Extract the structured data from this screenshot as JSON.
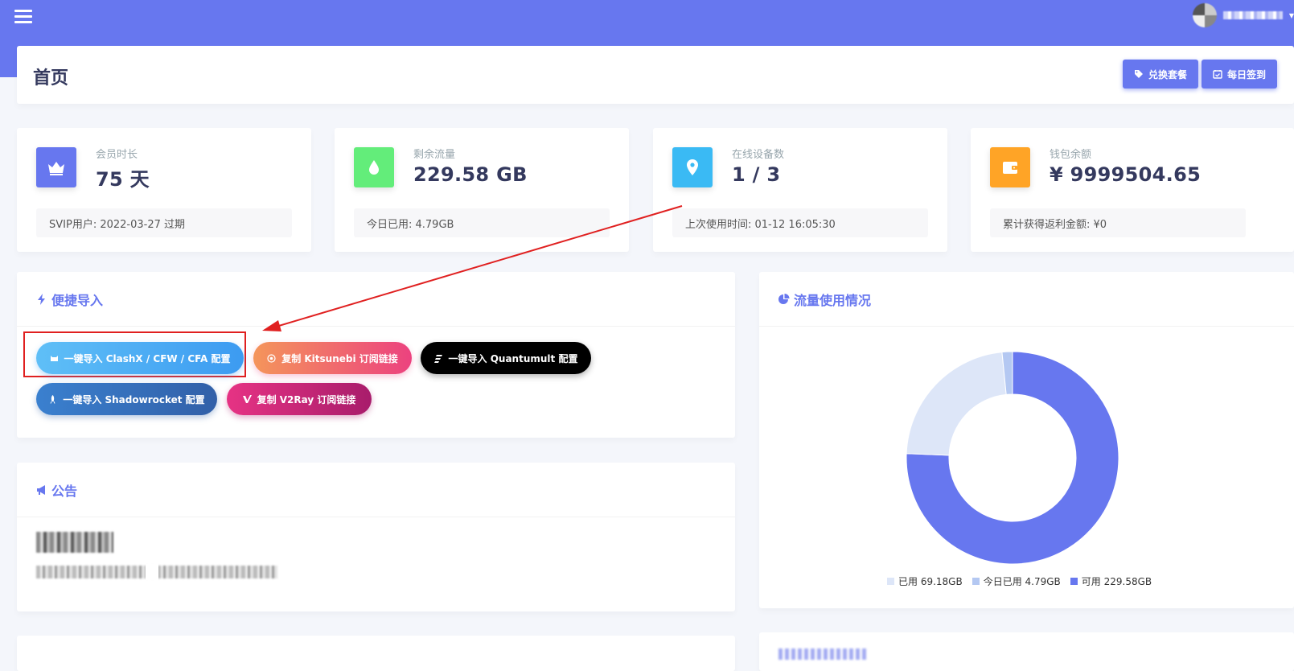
{
  "header": {
    "title": "首页",
    "buttons": [
      {
        "label": "兑换套餐",
        "icon": "tag-icon"
      },
      {
        "label": "每日签到",
        "icon": "calendar-check-icon"
      }
    ]
  },
  "stats": [
    {
      "label": "会员时长",
      "value": "75 天",
      "footer": "SVIP用户: 2022-03-27 过期",
      "icon": "crown-icon",
      "color": "#6777ef"
    },
    {
      "label": "剩余流量",
      "value": "229.58 GB",
      "footer": "今日已用: 4.79GB",
      "icon": "droplet-icon",
      "color": "#63ed7a"
    },
    {
      "label": "在线设备数",
      "value": "1 / 3",
      "footer": "上次使用时间: 01-12 16:05:30",
      "icon": "map-pin-icon",
      "color": "#3abaf4"
    },
    {
      "label": "钱包余额",
      "value": "¥ 9999504.65",
      "footer": "累计获得返利金额: ¥0",
      "icon": "wallet-icon",
      "color": "#ffa426"
    }
  ],
  "quick_import": {
    "title": "便捷导入",
    "buttons": [
      {
        "label": "一键导入 ClashX / CFW / CFA 配置",
        "icon": "cat-icon"
      },
      {
        "label": "复制 Kitsunebi 订阅链接",
        "icon": "kitsunebi-icon"
      },
      {
        "label": "一键导入 Quantumult 配置",
        "icon": "quantumult-icon"
      },
      {
        "label": "一键导入 Shadowrocket 配置",
        "icon": "rocket-icon"
      },
      {
        "label": "复制 V2Ray 订阅链接",
        "icon": "v2ray-icon"
      }
    ]
  },
  "notice": {
    "title": "公告"
  },
  "traffic": {
    "title": "流量使用情况",
    "legend": [
      {
        "label": "已用 69.18GB",
        "color": "#dde6f8"
      },
      {
        "label": "今日已用 4.79GB",
        "color": "#b4c8f2"
      },
      {
        "label": "可用 229.58GB",
        "color": "#6777ef"
      }
    ]
  },
  "chart_data": {
    "type": "pie",
    "title": "",
    "categories": [
      "已用",
      "今日已用",
      "可用"
    ],
    "values": [
      69.18,
      4.79,
      229.58
    ],
    "colors": [
      "#dde6f8",
      "#b4c8f2",
      "#6777ef"
    ],
    "donut": true,
    "legend": "bottom"
  }
}
